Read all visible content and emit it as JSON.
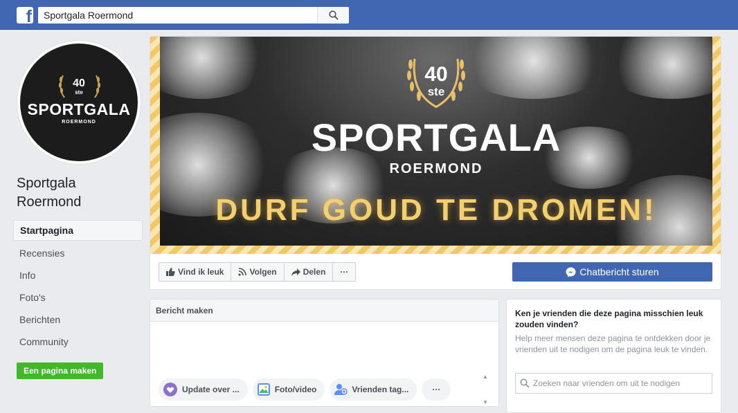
{
  "topbar": {
    "logo": "f",
    "search_value": "Sportgala Roermond"
  },
  "profile_pic": {
    "number": "40",
    "suffix": "ste",
    "title": "SPORTGALA",
    "subtitle": "ROERMOND"
  },
  "page": {
    "name": "Sportgala Roermond"
  },
  "nav": {
    "items": [
      {
        "label": "Startpagina"
      },
      {
        "label": "Recensies"
      },
      {
        "label": "Info"
      },
      {
        "label": "Foto's"
      },
      {
        "label": "Berichten"
      },
      {
        "label": "Community"
      }
    ],
    "create_page": "Een pagina maken"
  },
  "cover": {
    "number": "40",
    "suffix": "ste",
    "title": "SPORTGALA",
    "subtitle": "ROERMOND",
    "slogan": "DURF GOUD TE DROMEN!",
    "colors": {
      "gold": "#f4cf6e",
      "stripe_light": "#fbe7b4",
      "stripe_dark": "#f2c866"
    }
  },
  "actions": {
    "like": "Vind ik leuk",
    "follow": "Volgen",
    "share": "Delen",
    "more": "···",
    "chat": "Chatbericht sturen"
  },
  "composer": {
    "header": "Bericht maken",
    "options": [
      {
        "label": "Update over ...",
        "icon": "update-icon"
      },
      {
        "label": "Foto/video",
        "icon": "photo-icon"
      },
      {
        "label": "Vrienden tag...",
        "icon": "tag-friends-icon"
      }
    ],
    "more": "···"
  },
  "suggest": {
    "title": "Ken je vrienden die deze pagina misschien leuk zouden vinden?",
    "description": "Help meer mensen deze pagina te ontdekken door je vrienden uit te nodigen om de pagina leuk te vinden.",
    "placeholder": "Zoeken naar vrienden om uit te nodigen"
  },
  "colors": {
    "brand": "#4267b2",
    "background": "#e9ebee",
    "green": "#42b72a"
  }
}
